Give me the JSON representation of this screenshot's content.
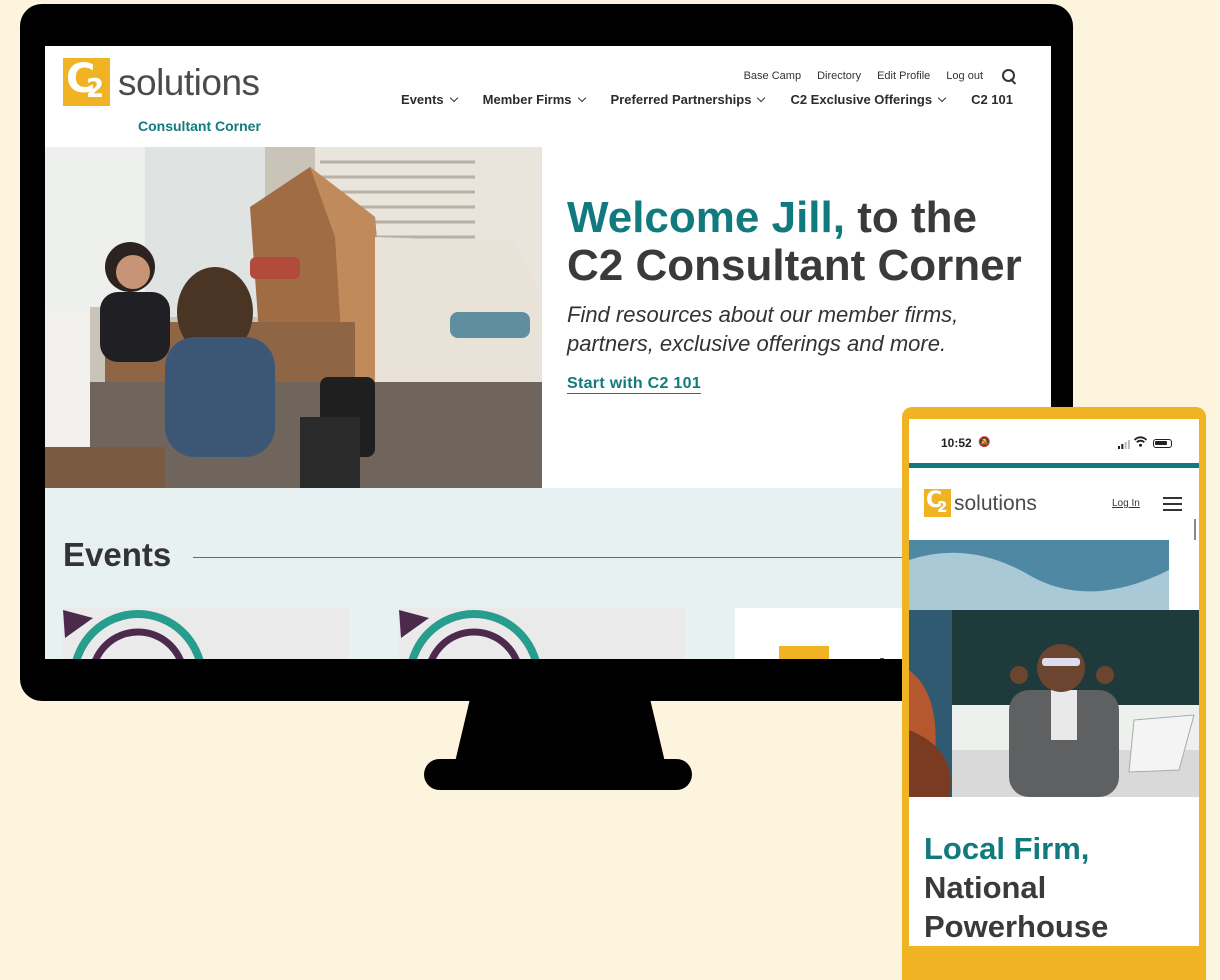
{
  "desktop": {
    "logo": {
      "word": "solutions",
      "mark_c": "C",
      "mark_2": "2",
      "subtitle": "Consultant Corner"
    },
    "utility_nav": [
      "Base Camp",
      "Directory",
      "Edit Profile",
      "Log out"
    ],
    "main_nav": [
      "Events",
      "Member Firms",
      "Preferred Partnerships",
      "C2 Exclusive Offerings",
      "C2 101"
    ],
    "hero": {
      "title_accent": "Welcome Jill,",
      "title_rest": " to the C2 Consultant Corner",
      "subtitle": "Find resources about our member firms, partners, exclusive offerings and more.",
      "link": "Start with C2 101"
    },
    "events": {
      "title": "Events"
    }
  },
  "mobile": {
    "status": {
      "time": "10:52"
    },
    "logo": {
      "word": "solutions",
      "mark_c": "C",
      "mark_2": "2"
    },
    "login": "Log In",
    "headline_accent": "Local Firm,",
    "headline_rest": " National Powerhouse"
  },
  "colors": {
    "brand_yellow": "#f0b323",
    "teal": "#107a7e",
    "background": "#fdf4de",
    "events_bg": "#e7f1f1"
  },
  "icons": [
    "search-icon",
    "chevron-down-icon",
    "bell-icon",
    "signal-icon",
    "wifi-icon",
    "battery-icon",
    "hamburger-icon"
  ]
}
